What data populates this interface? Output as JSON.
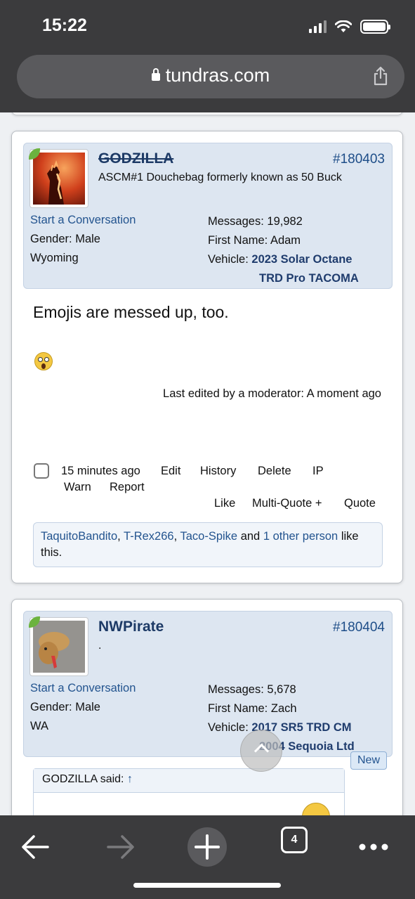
{
  "status_bar": {
    "time": "15:22"
  },
  "browser": {
    "url": "tundras.com",
    "tab_count": "4"
  },
  "posts": [
    {
      "username": "GODZILLA",
      "post_number": "#180403",
      "user_title": "ASCM#1 Douchebag formerly known as 50 Buck",
      "start_conversation": "Start a Conversation",
      "gender": "Gender: Male",
      "location": "Wyoming",
      "messages_label": "Messages:",
      "messages": "19,982",
      "first_name_label": "First Name:",
      "first_name": "Adam",
      "vehicle_label": "Vehicle:",
      "vehicle_line1": "2023 Solar Octane",
      "vehicle_line2": "TRD Pro TACOMA",
      "body": "Emojis are messed up, too.",
      "edited": "Last edited by a moderator: A moment ago",
      "time_ago": "15 minutes ago",
      "actions": [
        "Edit",
        "History",
        "Delete",
        "IP",
        "Warn",
        "Report"
      ],
      "reactions": [
        "Like",
        "Multi-Quote +",
        "Quote"
      ],
      "likes": {
        "users": [
          "TaquitoBandito",
          "T-Rex266",
          "Taco-Spike"
        ],
        "and": "and",
        "other": "1 other person",
        "suffix": "like this."
      }
    },
    {
      "username": "NWPirate",
      "post_number": "#180404",
      "user_title": ".",
      "start_conversation": "Start a Conversation",
      "gender": "Gender: Male",
      "location": "WA",
      "messages_label": "Messages:",
      "messages": "5,678",
      "first_name_label": "First Name:",
      "first_name": "Zach",
      "vehicle_label": "Vehicle:",
      "vehicle_line1": "2017 SR5 TRD CM",
      "vehicle_line2": "2004 Sequoia Ltd",
      "new_badge": "New",
      "quote_author": "GODZILLA said:",
      "quote_arrow": "↑"
    }
  ]
}
